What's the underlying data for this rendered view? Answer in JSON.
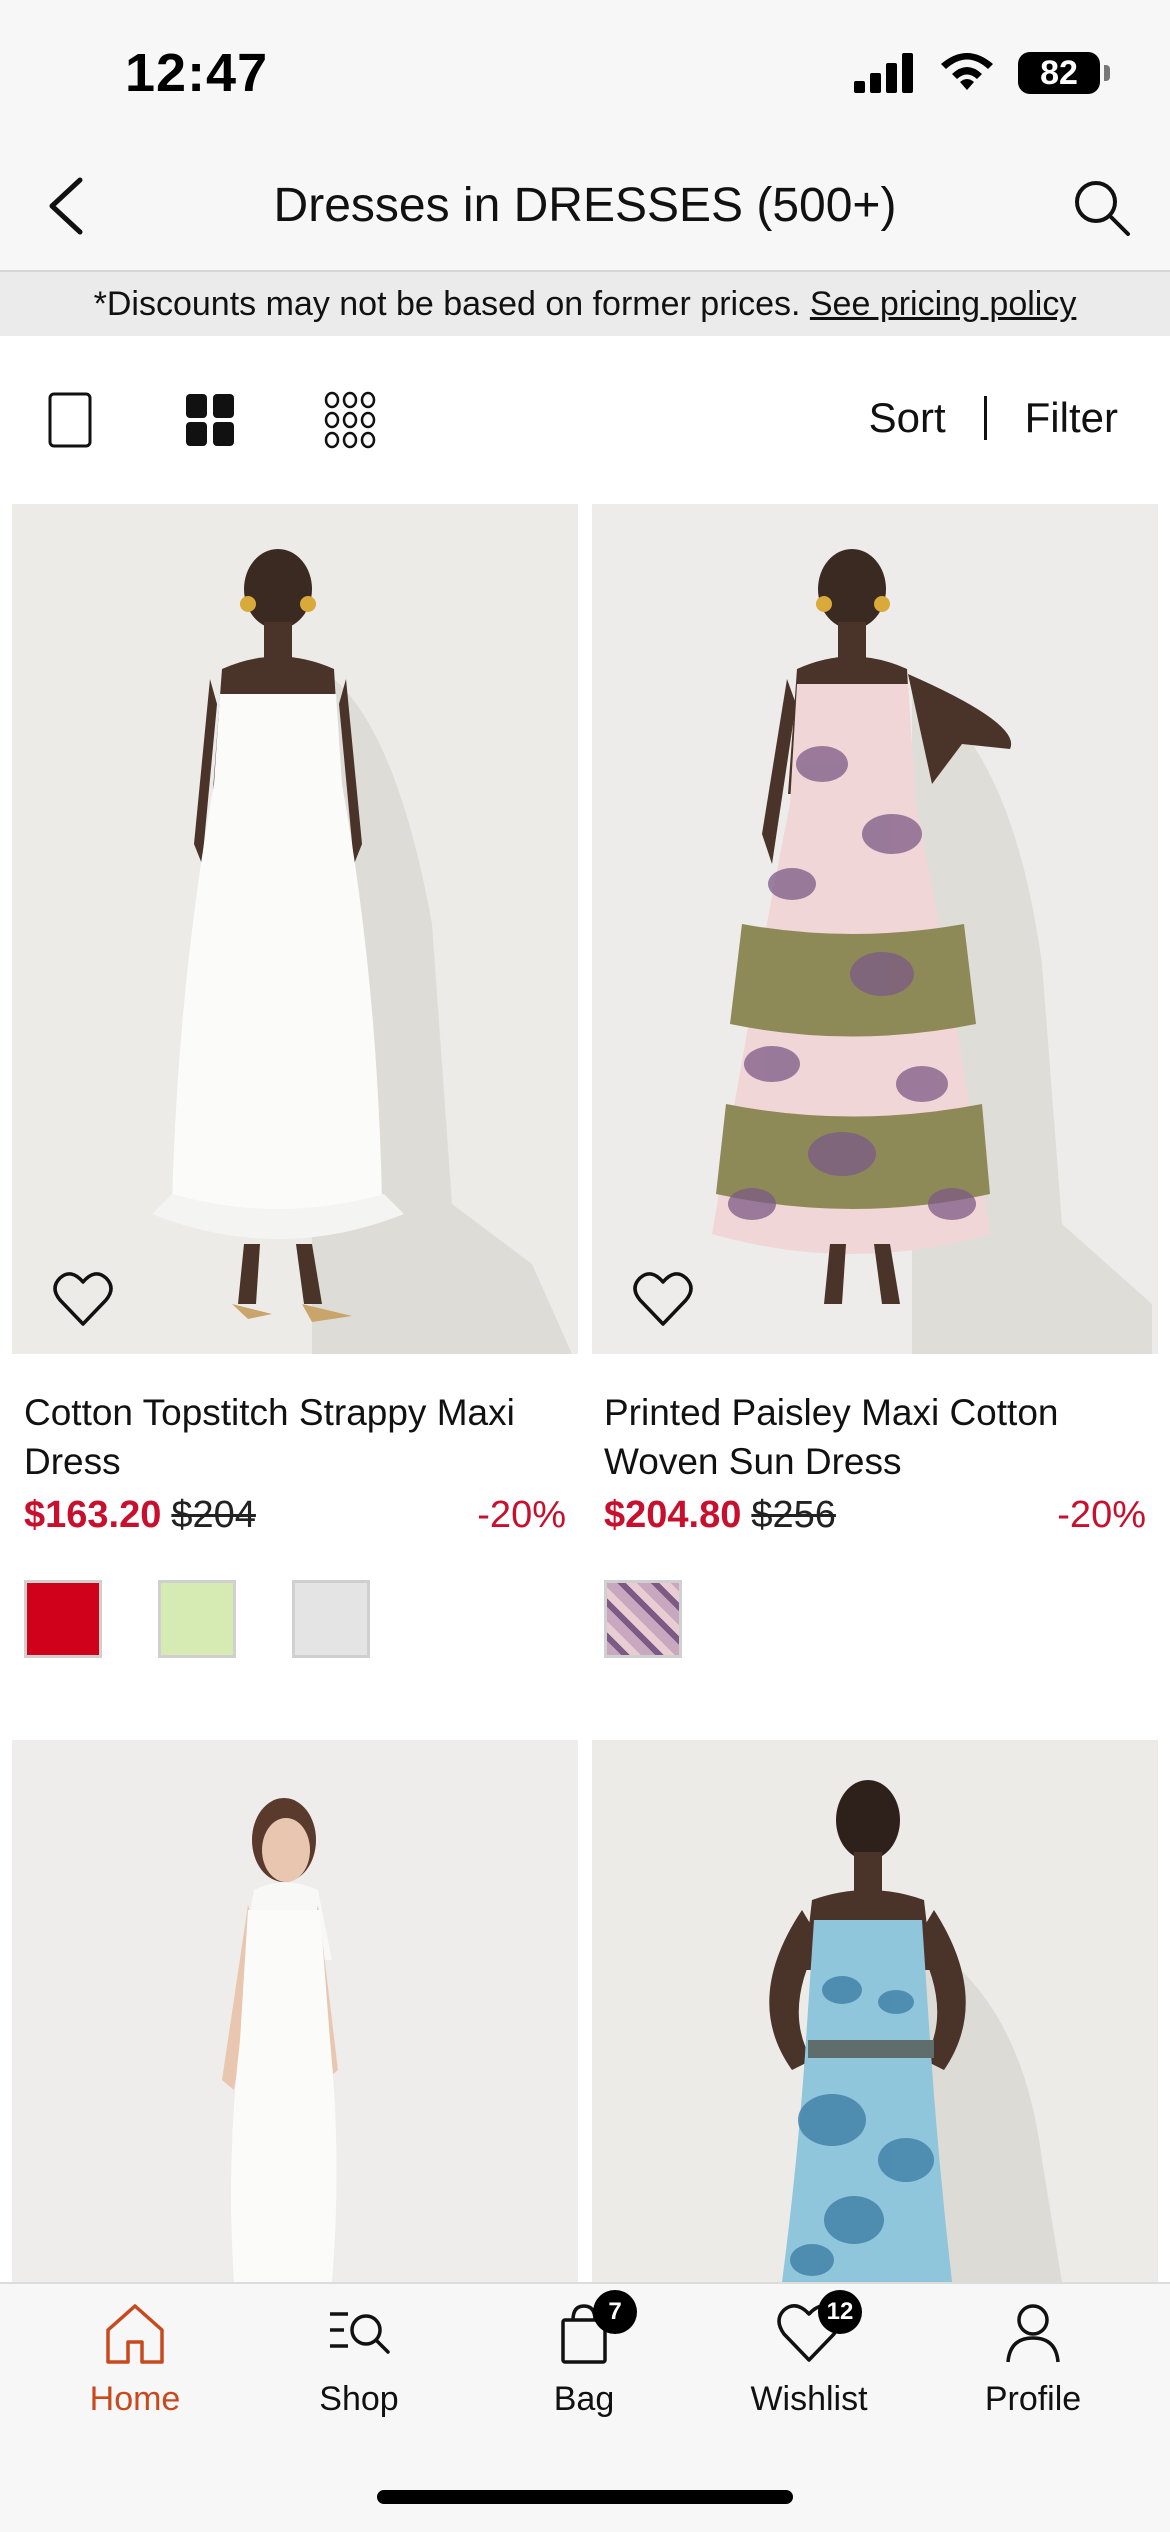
{
  "status_bar": {
    "time": "12:47",
    "battery": "82"
  },
  "header": {
    "title": "Dresses in DRESSES (500+)"
  },
  "pricing_banner": {
    "text": "*Discounts may not be based on former prices.",
    "link": "See pricing policy"
  },
  "toolbar": {
    "sort_label": "Sort",
    "filter_label": "Filter"
  },
  "products": [
    {
      "name": "Cotton Topstitch Strappy Maxi Dress",
      "price": "$163.20",
      "was_price": "$204",
      "discount": "-20%",
      "swatch_colors": [
        "#d0021b",
        "#d6eab4",
        "#e4e4e4"
      ]
    },
    {
      "name": "Printed Paisley Maxi Cotton Woven Sun Dress",
      "price": "$204.80",
      "was_price": "$256",
      "discount": "-20%",
      "swatch_colors": [
        "#b79ab0"
      ]
    }
  ],
  "tab_bar": {
    "home": "Home",
    "shop": "Shop",
    "bag": "Bag",
    "bag_count": "7",
    "wishlist": "Wishlist",
    "wishlist_count": "12",
    "profile": "Profile"
  },
  "colors": {
    "accent": "#c8102e",
    "tab_active": "#c74a1f"
  }
}
